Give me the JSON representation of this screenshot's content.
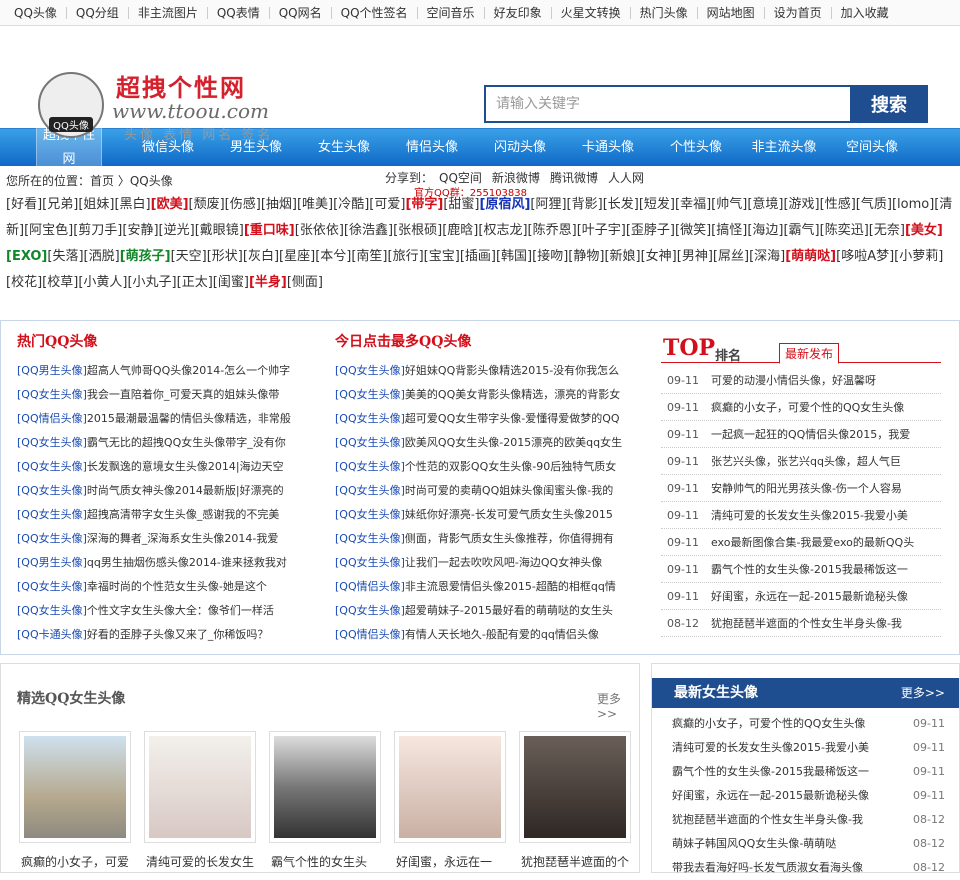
{
  "topbar": [
    "QQ头像",
    "QQ分组",
    "非主流图片",
    "QQ表情",
    "QQ网名",
    "QQ个性签名",
    "空间音乐",
    "好友印象",
    "火星文转换",
    "热门头像",
    "网站地图",
    "设为首页",
    "加入收藏"
  ],
  "logo": {
    "title": "超拽个性网",
    "url": "www.ttoou.com",
    "slogan": "头像 表情 网名 签名",
    "badge": "QQ头像"
  },
  "search": {
    "placeholder": "请输入关键字",
    "button": "搜索"
  },
  "nav": [
    "超拽个性网",
    "微信头像",
    "男生头像",
    "女生头像",
    "情侣头像",
    "闪动头像",
    "卡通头像",
    "个性头像",
    "非主流头像",
    "空间头像"
  ],
  "crumb": {
    "loc": "您所在的位置：首页 〉QQ头像",
    "share_label": "分享到：",
    "share": [
      "QQ空间",
      "新浪微博",
      "腾讯微博",
      "人人网"
    ],
    "qq": "官方QQ群：255103838"
  },
  "tags": [
    [
      "[好看]",
      ""
    ],
    [
      "[兄弟]",
      ""
    ],
    [
      "[姐妹]",
      ""
    ],
    [
      "[黑白]",
      ""
    ],
    [
      "[欧美]",
      "r"
    ],
    [
      "[颓废]",
      ""
    ],
    [
      "[伤感]",
      ""
    ],
    [
      "[抽烟]",
      ""
    ],
    [
      "[唯美]",
      ""
    ],
    [
      "[冷酷]",
      ""
    ],
    [
      "[可爱]",
      ""
    ],
    [
      "[带字]",
      "r"
    ],
    [
      "[甜蜜]",
      ""
    ],
    [
      "[原宿风]",
      "b"
    ],
    [
      "[阿狸]",
      ""
    ],
    [
      "[背影]",
      ""
    ],
    [
      "[长发]",
      ""
    ],
    [
      "[短发]",
      ""
    ],
    [
      "[幸福]",
      ""
    ],
    [
      "[帅气]",
      ""
    ],
    [
      "[意境]",
      ""
    ],
    [
      "[游戏]",
      ""
    ],
    [
      "[性感]",
      ""
    ],
    [
      "[气质]",
      ""
    ],
    [
      "[lomo]",
      ""
    ],
    [
      "[清新]",
      ""
    ],
    [
      "[阿宝色]",
      ""
    ],
    [
      "[剪刀手]",
      ""
    ],
    [
      "[安静]",
      ""
    ],
    [
      "[逆光]",
      ""
    ],
    [
      "[戴眼镜]",
      ""
    ],
    [
      "[重口味]",
      "r"
    ],
    [
      "[张依依]",
      ""
    ],
    [
      "[徐浩鑫]",
      ""
    ],
    [
      "[张根硕]",
      ""
    ],
    [
      "[鹿晗]",
      ""
    ],
    [
      "[权志龙]",
      ""
    ],
    [
      "[陈乔恩]",
      ""
    ],
    [
      "[叶子宇]",
      ""
    ],
    [
      "[歪脖子]",
      ""
    ],
    [
      "[微笑]",
      ""
    ],
    [
      "[搞怪]",
      ""
    ],
    [
      "[海边]",
      ""
    ],
    [
      "[霸气]",
      ""
    ],
    [
      "[陈奕迅]",
      ""
    ],
    [
      "[无奈]",
      ""
    ],
    [
      "[美女]",
      "r"
    ],
    [
      "[EXO]",
      "g"
    ],
    [
      "[失落]",
      ""
    ],
    [
      "[洒脱]",
      ""
    ],
    [
      "[萌孩子]",
      "g"
    ],
    [
      "[天空]",
      ""
    ],
    [
      "[形状]",
      ""
    ],
    [
      "[灰白]",
      ""
    ],
    [
      "[星座]",
      ""
    ],
    [
      "[本兮]",
      ""
    ],
    [
      "[南笙]",
      ""
    ],
    [
      "[旅行]",
      ""
    ],
    [
      "[宝宝]",
      ""
    ],
    [
      "[插画]",
      ""
    ],
    [
      "[韩国]",
      ""
    ],
    [
      "[接吻]",
      ""
    ],
    [
      "[静物]",
      ""
    ],
    [
      "[新娘]",
      ""
    ],
    [
      "[女神]",
      ""
    ],
    [
      "[男神]",
      ""
    ],
    [
      "[屌丝]",
      ""
    ],
    [
      "[深海]",
      ""
    ],
    [
      "[萌萌哒]",
      "r"
    ],
    [
      "[哆啦A梦]",
      ""
    ],
    [
      "[小萝莉]",
      ""
    ],
    [
      "[校花]",
      ""
    ],
    [
      "[校草]",
      ""
    ],
    [
      "[小黄人]",
      ""
    ],
    [
      "[小丸子]",
      ""
    ],
    [
      "[正太]",
      ""
    ],
    [
      "[闺蜜]",
      ""
    ],
    [
      "[半身]",
      "r"
    ],
    [
      "[侧面]",
      ""
    ]
  ],
  "hot": {
    "title": "热门QQ头像",
    "items": [
      [
        "[QQ男生头像]",
        "超高人气帅哥QQ头像2014-怎么一个帅字"
      ],
      [
        "[QQ女生头像]",
        "我会一直陪着你_可爱天真的姐妹头像带"
      ],
      [
        "[QQ情侣头像]",
        "2015最潮最温馨的情侣头像精选，非常般"
      ],
      [
        "[QQ女生头像]",
        "霸气无比的超拽QQ女生头像带字_没有你"
      ],
      [
        "[QQ女生头像]",
        "长发飘逸的意境女生头像2014|海边天空"
      ],
      [
        "[QQ女生头像]",
        "时尚气质女神头像2014最新版|好漂亮的"
      ],
      [
        "[QQ女生头像]",
        "超拽高清带字女生头像_感谢我的不完美"
      ],
      [
        "[QQ女生头像]",
        "深海的舞者_深海系女生头像2014-我爱"
      ],
      [
        "[QQ男生头像]",
        "qq男生抽烟伤感头像2014-谁来拯救我对"
      ],
      [
        "[QQ女生头像]",
        "幸福时尚的个性范女生头像-她是这个"
      ],
      [
        "[QQ女生头像]",
        "个性文字女生头像大全：像爷们一样活"
      ],
      [
        "[QQ卡通头像]",
        "好看的歪脖子头像又来了_你稀饭吗？"
      ]
    ]
  },
  "today": {
    "title": "今日点击最多QQ头像",
    "items": [
      [
        "[QQ女生头像]",
        "好姐妹QQ背影头像精选2015-没有你我怎么"
      ],
      [
        "[QQ女生头像]",
        "美美的QQ美女背影头像精选，漂亮的背影女"
      ],
      [
        "[QQ女生头像]",
        "超可爱QQ女生带字头像-爱懂得爱做梦的QQ"
      ],
      [
        "[QQ女生头像]",
        "欧美风QQ女生头像-2015漂亮的欧美qq女生"
      ],
      [
        "[QQ女生头像]",
        "个性范的双影QQ女生头像-90后独特气质女"
      ],
      [
        "[QQ女生头像]",
        "时尚可爱的卖萌QQ姐妹头像闺蜜头像-我的"
      ],
      [
        "[QQ女生头像]",
        "妹纸你好漂亮-长发可爱气质女生头像2015"
      ],
      [
        "[QQ女生头像]",
        "侧面，背影气质女生头像推荐，你值得拥有"
      ],
      [
        "[QQ女生头像]",
        "让我们一起去吹吹风吧-海边QQ女神头像"
      ],
      [
        "[QQ情侣头像]",
        "非主流恩爱情侣头像2015-超酷的相框qq情"
      ],
      [
        "[QQ女生头像]",
        "超爱萌妹子-2015最好看的萌萌哒的女生头"
      ],
      [
        "[QQ情侣头像]",
        "有情人天长地久-般配有爱的qq情侣头像"
      ]
    ]
  },
  "top": {
    "big": "TOP",
    "small": "排名",
    "tab": "最新发布",
    "items": [
      [
        "09-11",
        "可爱的动漫小情侣头像，好温馨呀"
      ],
      [
        "09-11",
        "疯癫的小女子，可爱个性的QQ女生头像"
      ],
      [
        "09-11",
        "一起疯一起狂的QQ情侣头像2015，我爱"
      ],
      [
        "09-11",
        "张艺兴头像，张艺兴qq头像，超人气巨"
      ],
      [
        "09-11",
        "安静帅气的阳光男孩头像-伤一个人容易"
      ],
      [
        "09-11",
        "清纯可爱的长发女生头像2015-我爱小美"
      ],
      [
        "09-11",
        "exo最新图像合集-我最爱exo的最新QQ头"
      ],
      [
        "09-11",
        "霸气个性的女生头像-2015我最稀饭这一"
      ],
      [
        "09-11",
        "好闺蜜，永远在一起-2015最新诡秘头像"
      ],
      [
        "08-12",
        "犹抱琵琶半遮面的个性女生半身头像-我"
      ]
    ]
  },
  "picks": {
    "title": "精选QQ女生头像",
    "more": "更多>>",
    "items": [
      "疯癫的小女子，可爱",
      "清纯可爱的长发女生",
      "霸气个性的女生头",
      "好闺蜜，永远在一",
      "犹抱琵琶半遮面的个"
    ]
  },
  "latest": {
    "title": "最新女生头像",
    "more": "更多>>",
    "items": [
      [
        "疯癫的小女子，可爱个性的QQ女生头像",
        "09-11"
      ],
      [
        "清纯可爱的长发女生头像2015-我爱小美",
        "09-11"
      ],
      [
        "霸气个性的女生头像-2015我最稀饭这一",
        "09-11"
      ],
      [
        "好闺蜜，永远在一起-2015最新诡秘头像",
        "09-11"
      ],
      [
        "犹抱琵琶半遮面的个性女生半身头像-我",
        "08-12"
      ],
      [
        "萌妹子韩国风QQ女生头像-萌萌哒",
        "08-12"
      ],
      [
        "带我去看海好吗-长发气质淑女看海头像",
        "08-12"
      ]
    ]
  }
}
